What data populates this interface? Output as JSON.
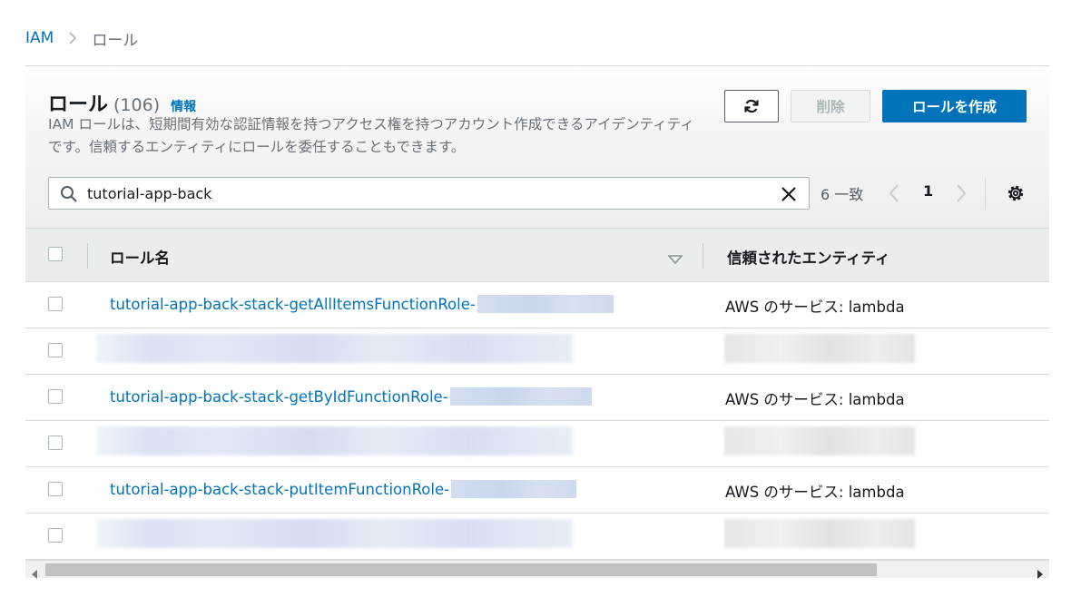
{
  "breadcrumb": {
    "root": "IAM",
    "current": "ロール"
  },
  "header": {
    "title": "ロール",
    "count": "(106)",
    "info_link": "情報",
    "description": "IAM ロールは、短期間有効な認証情報を持つアクセス権を持つアカウント作成できるアイデンティティです。信頼するエンティティにロールを委任することもできます。"
  },
  "actions": {
    "refresh_icon": "refresh-icon",
    "delete_label": "削除",
    "create_label": "ロールを作成"
  },
  "search": {
    "value": "tutorial-app-back",
    "placeholder": ""
  },
  "pagination": {
    "matches": "6 一致",
    "current_page": "1"
  },
  "table": {
    "columns": {
      "role_name": "ロール名",
      "trusted_entity": "信頼されたエンティティ"
    },
    "rows": [
      {
        "name": "tutorial-app-back-stack-getAllItemsFunctionRole-",
        "trusted": "AWS のサービス: lambda",
        "redacted": false
      },
      {
        "name": "",
        "trusted": "",
        "redacted": true
      },
      {
        "name": "tutorial-app-back-stack-getByIdFunctionRole-",
        "trusted": "AWS のサービス: lambda",
        "redacted": false
      },
      {
        "name": "",
        "trusted": "",
        "redacted": true
      },
      {
        "name": "tutorial-app-back-stack-putItemFunctionRole-",
        "trusted": "AWS のサービス: lambda",
        "redacted": false
      },
      {
        "name": "",
        "trusted": "",
        "redacted": true
      }
    ]
  },
  "colors": {
    "link": "#0073bb",
    "primary_button": "#0073bb",
    "muted_text": "#687078"
  }
}
